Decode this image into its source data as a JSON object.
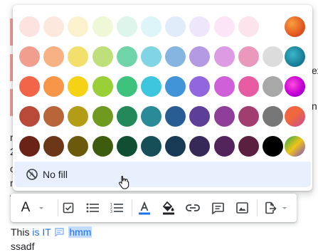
{
  "popup": {
    "swatch_rows": [
      [
        "#fde3e0",
        "#fce8dd",
        "#fbf1cd",
        "#eef7d6",
        "#ddf5eb",
        "#ddf4f9",
        "#e1ecfa",
        "#eee6fb",
        "#fbe5f7",
        "#fbe4ec"
      ],
      [
        "#f29e8f",
        "#f7b184",
        "#f3df6c",
        "#bfdf7b",
        "#6fd4a8",
        "#80d4e4",
        "#85b5e0",
        "#b39ae2",
        "#dc9be2",
        "#ea99bd",
        "#dcdcdc"
      ],
      [
        "#f26548",
        "#f79549",
        "#f6d215",
        "#9ad037",
        "#3ec27c",
        "#3ec6df",
        "#4194d8",
        "#9266de",
        "#d060d7",
        "#e75ba2",
        "#a8a8a8"
      ],
      [
        "#b94a3a",
        "#b9653a",
        "#b39d17",
        "#6d9a1f",
        "#23885a",
        "#2a8a98",
        "#275d93",
        "#5d3f9a",
        "#8e3d98",
        "#a23d6f",
        "#777777"
      ],
      [
        "#6b2318",
        "#6b3718",
        "#6b5a0b",
        "#3e5c0e",
        "#114f33",
        "#164f57",
        "#193a55",
        "#372957",
        "#52245b",
        "#5b1f40",
        "#000000"
      ]
    ],
    "rainbow_swatches": [
      "conic-orange",
      "conic-teal",
      "conic-magenta",
      "conic-coral",
      "conic-green"
    ],
    "no_fill_label": "No fill",
    "no_fill_icon": "no-fill-icon"
  },
  "toolbar": {
    "font_letter": "A",
    "icons": [
      "text-style-icon",
      "checklist-icon",
      "bulleted-list-icon",
      "numbered-list-icon",
      "text-color-icon",
      "fill-color-icon",
      "link-icon",
      "comment-icon",
      "image-icon",
      "export-icon"
    ],
    "text_color_accent": "#1a73e8"
  },
  "document": {
    "text_before": "This",
    "link_text": "is IT",
    "comment_icon": "comment-icon",
    "highlighted_text": "hmm",
    "next_line": "ssadf",
    "left_fragments": [
      "r",
      "2",
      "c",
      "r",
      "V"
    ],
    "right_fragments": [
      "ex",
      "n"
    ]
  }
}
